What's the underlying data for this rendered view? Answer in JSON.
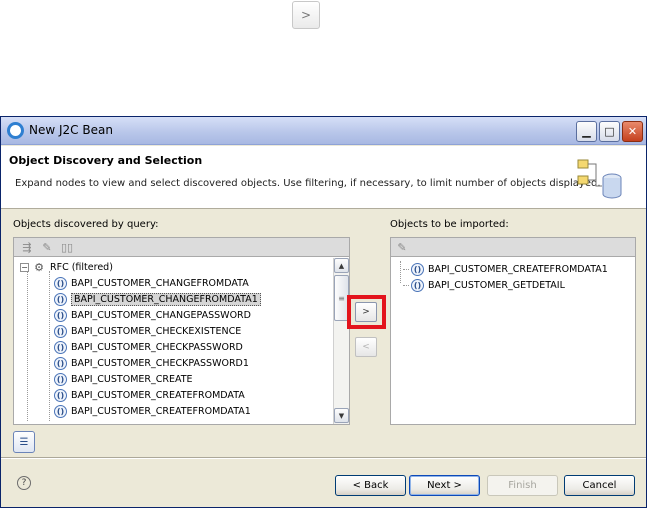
{
  "floating": {
    "arrow_glyph": ">"
  },
  "window": {
    "title": "New J2C Bean",
    "minimize_glyph": "▁",
    "maximize_glyph": "□",
    "close_glyph": "✕"
  },
  "banner": {
    "title": "Object Discovery and Selection",
    "description": "Expand nodes to view and select discovered objects. Use filtering, if necessary, to limit number of objects displayed."
  },
  "left_panel": {
    "label": "Objects discovered by query:",
    "root": {
      "label": "RFC (filtered)",
      "expander": "⊟"
    },
    "items": [
      {
        "label": "BAPI_CUSTOMER_CHANGEFROMDATA",
        "selected": false
      },
      {
        "label": "BAPI_CUSTOMER_CHANGEFROMDATA1",
        "selected": true
      },
      {
        "label": "BAPI_CUSTOMER_CHANGEPASSWORD",
        "selected": false
      },
      {
        "label": "BAPI_CUSTOMER_CHECKEXISTENCE",
        "selected": false
      },
      {
        "label": "BAPI_CUSTOMER_CHECKPASSWORD",
        "selected": false
      },
      {
        "label": "BAPI_CUSTOMER_CHECKPASSWORD1",
        "selected": false
      },
      {
        "label": "BAPI_CUSTOMER_CREATE",
        "selected": false
      },
      {
        "label": "BAPI_CUSTOMER_CREATEFROMDATA",
        "selected": false
      },
      {
        "label": "BAPI_CUSTOMER_CREATEFROMDATA1",
        "selected": false
      }
    ]
  },
  "transfer": {
    "add_glyph": ">",
    "remove_glyph": "<"
  },
  "right_panel": {
    "label": "Objects to be imported:",
    "items": [
      {
        "label": "BAPI_CUSTOMER_CREATEFROMDATA1"
      },
      {
        "label": "BAPI_CUSTOMER_GETDETAIL"
      }
    ]
  },
  "footer": {
    "help_glyph": "?",
    "back_label": "< Back",
    "next_label": "Next >",
    "finish_label": "Finish",
    "cancel_label": "Cancel"
  },
  "colors": {
    "highlight": "#e3141c",
    "title_bar": "#b9c7ea",
    "dialog_bg": "#ece9d8"
  }
}
